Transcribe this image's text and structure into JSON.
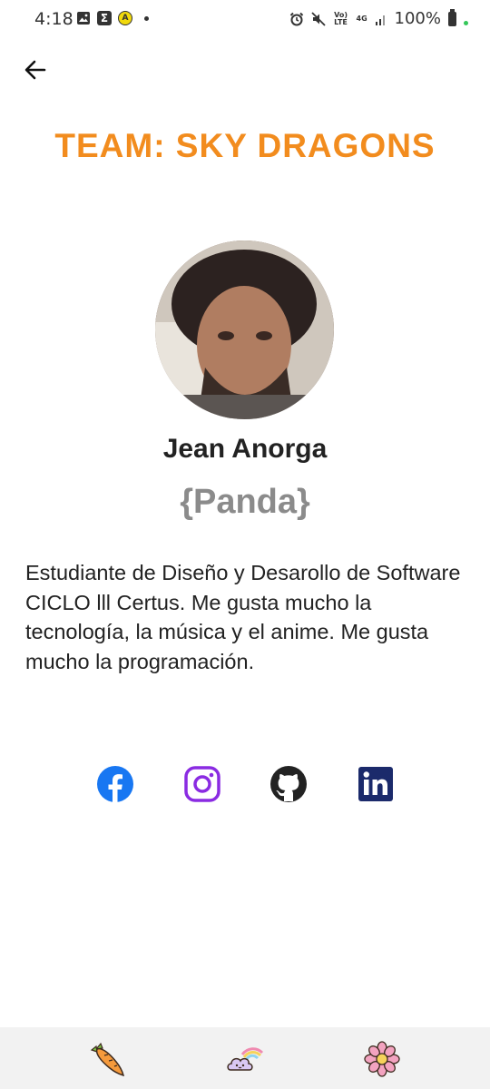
{
  "status_bar": {
    "time": "4:18",
    "battery": "100%",
    "left_icons": [
      "image-icon",
      "sigma-icon",
      "a-badge-icon",
      "dot"
    ],
    "right_icons": [
      "alarm-icon",
      "mute-icon",
      "volte-icon",
      "4g-icon",
      "signal-icon",
      "battery-icon"
    ],
    "volte_label": "Vo) LTE",
    "net_label": "4G",
    "sigma": "Σ",
    "a_badge": "A"
  },
  "header": {
    "back_icon": "arrow-left-icon"
  },
  "team": {
    "title": "TEAM: SKY DRAGONS",
    "title_color": "#f28c1e"
  },
  "member": {
    "name": "Jean Anorga",
    "nickname": "{Panda}",
    "bio": "Estudiante de Diseño y Desarollo de Software CICLO lll Certus. Me gusta mucho la tecnología, la música y el anime. Me gusta mucho la programación."
  },
  "social_links": [
    {
      "icon": "facebook-icon",
      "color": "#1877f2"
    },
    {
      "icon": "instagram-icon",
      "color": "#8a2be2"
    },
    {
      "icon": "github-icon",
      "color": "#222222"
    },
    {
      "icon": "linkedin-icon",
      "color": "#1b2a6b"
    }
  ],
  "bottom_nav": [
    {
      "icon": "carrot-icon"
    },
    {
      "icon": "rainbow-cloud-icon"
    },
    {
      "icon": "flower-icon"
    }
  ]
}
